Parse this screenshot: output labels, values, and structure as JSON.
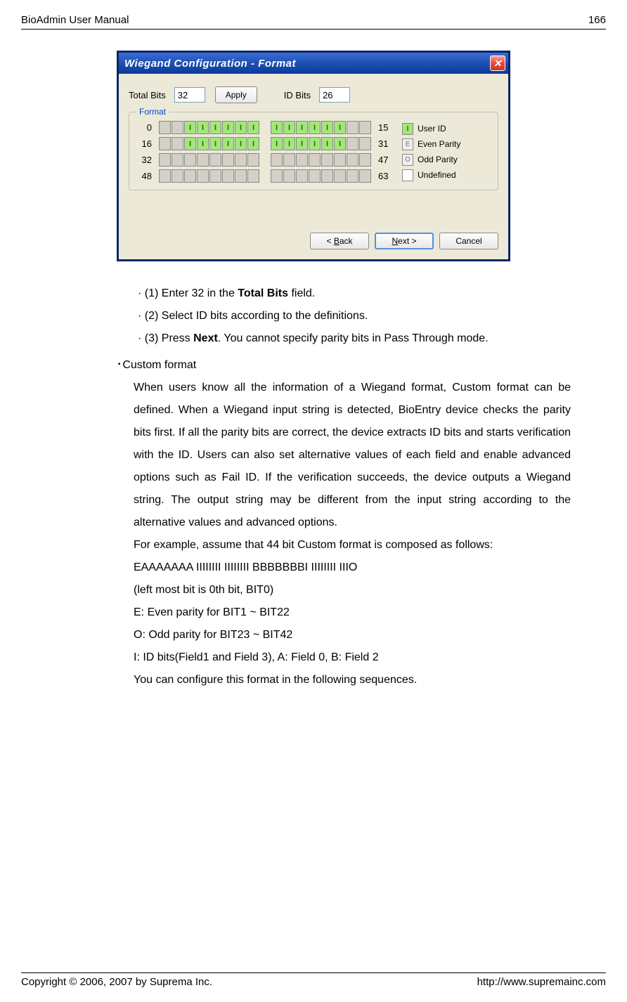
{
  "header": {
    "title": "BioAdmin User Manual",
    "page": "166"
  },
  "dialog": {
    "title": "Wiegand Configuration - Format",
    "total_bits_label": "Total Bits",
    "total_bits_value": "32",
    "apply": "Apply",
    "id_bits_label": "ID Bits",
    "id_bits_value": "26",
    "format_label": "Format",
    "rows": [
      {
        "start": "0",
        "end": "15",
        "bits_a": [
          " ",
          " ",
          "I",
          "I",
          "I",
          "I",
          "I",
          "I"
        ],
        "bits_b": [
          "I",
          "I",
          "I",
          "I",
          "I",
          "I",
          " ",
          " "
        ],
        "class_a": [
          "gray",
          "gray",
          "green",
          "green",
          "green",
          "green",
          "green",
          "green"
        ],
        "class_b": [
          "green",
          "green",
          "green",
          "green",
          "green",
          "green",
          "gray",
          "gray"
        ]
      },
      {
        "start": "16",
        "end": "31",
        "bits_a": [
          " ",
          " ",
          "I",
          "I",
          "I",
          "I",
          "I",
          "I"
        ],
        "bits_b": [
          "I",
          "I",
          "I",
          "I",
          "I",
          "I",
          " ",
          " "
        ],
        "class_a": [
          "gray",
          "gray",
          "green",
          "green",
          "green",
          "green",
          "green",
          "green"
        ],
        "class_b": [
          "green",
          "green",
          "green",
          "green",
          "green",
          "green",
          "gray",
          "gray"
        ]
      },
      {
        "start": "32",
        "end": "47",
        "bits_a": [
          " ",
          " ",
          " ",
          " ",
          " ",
          " ",
          " ",
          " "
        ],
        "bits_b": [
          " ",
          " ",
          " ",
          " ",
          " ",
          " ",
          " ",
          " "
        ],
        "class_a": [
          "gray",
          "gray",
          "gray",
          "gray",
          "gray",
          "gray",
          "gray",
          "gray"
        ],
        "class_b": [
          "gray",
          "gray",
          "gray",
          "gray",
          "gray",
          "gray",
          "gray",
          "gray"
        ]
      },
      {
        "start": "48",
        "end": "63",
        "bits_a": [
          " ",
          " ",
          " ",
          " ",
          " ",
          " ",
          " ",
          " "
        ],
        "bits_b": [
          " ",
          " ",
          " ",
          " ",
          " ",
          " ",
          " ",
          " "
        ],
        "class_a": [
          "gray",
          "gray",
          "gray",
          "gray",
          "gray",
          "gray",
          "gray",
          "gray"
        ],
        "class_b": [
          "gray",
          "gray",
          "gray",
          "gray",
          "gray",
          "gray",
          "gray",
          "gray"
        ]
      }
    ],
    "legend": [
      {
        "char": "I",
        "label": "User ID",
        "cls": "green"
      },
      {
        "char": "E",
        "label": "Even Parity",
        "cls": "lgray"
      },
      {
        "char": "O",
        "label": "Odd Parity",
        "cls": "lgray"
      },
      {
        "char": " ",
        "label": "Undefined",
        "cls": "white"
      }
    ],
    "back_btn": "< Back",
    "next_btn": "Next >",
    "cancel_btn": "Cancel"
  },
  "steps": {
    "s1a": "(1) Enter 32 in the ",
    "s1b": "Total Bits",
    "s1c": " field.",
    "s2": "(2) Select ID bits according to the definitions.",
    "s3a": "(3) Press ",
    "s3b": "Next",
    "s3c": ". You cannot specify parity bits in Pass Through mode."
  },
  "custom": {
    "title": "Custom format",
    "p1": "When users know all the information of a Wiegand format, Custom format can be defined. When a Wiegand input string is detected, BioEntry device checks the parity bits first. If all the parity bits are correct, the device extracts ID bits and starts verification with the ID. Users can also set alternative values of each field and enable advanced options such as Fail ID. If the verification succeeds, the device outputs a Wiegand string. The output string may be different from the input string according to the alternative values and advanced options.",
    "p2": "For example, assume that 44 bit Custom format is composed as follows:",
    "p3": "EAAAAAAA IIIIIIII IIIIIIII BBBBBBBI IIIIIIII IIIO",
    "p4": "(left most bit is 0th bit, BIT0)",
    "p5": "E: Even parity for BIT1 ~ BIT22",
    "p6": "O: Odd parity for BIT23 ~ BIT42",
    "p7": "I: ID bits(Field1 and Field 3), A: Field 0, B: Field 2",
    "p8": "You can configure this format in the following sequences."
  },
  "footer": {
    "copyright": "Copyright © 2006, 2007 by Suprema Inc.",
    "url": "http://www.supremainc.com"
  }
}
